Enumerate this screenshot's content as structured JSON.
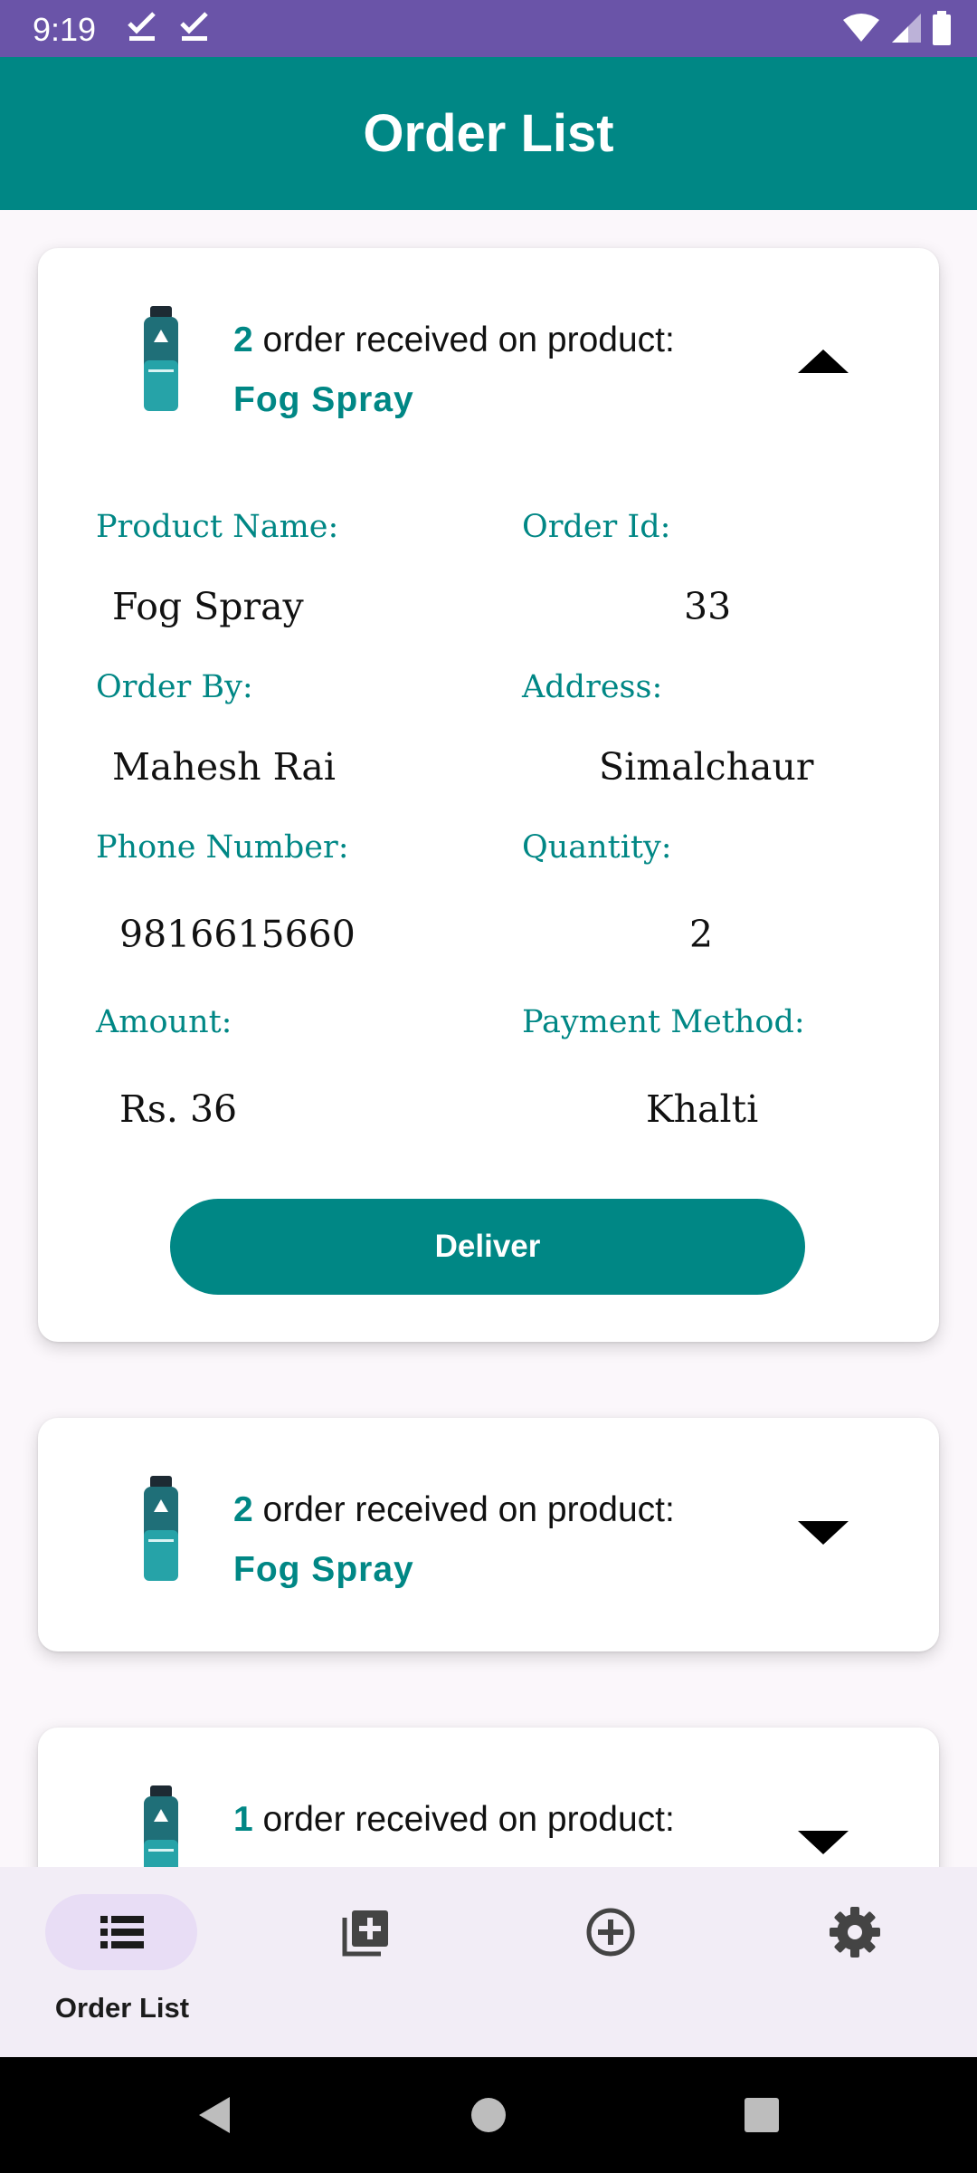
{
  "status_bar": {
    "time": "9:19",
    "icons": [
      "check-icon",
      "check-icon",
      "wifi-icon",
      "signal-icon",
      "battery-icon"
    ]
  },
  "app_bar": {
    "title": "Order List"
  },
  "colors": {
    "primary": "#008785",
    "status_bar": "#6a54a8",
    "nav_background": "#f2edf6",
    "nav_active_pill": "#e8ddf5"
  },
  "orders": [
    {
      "count": "2",
      "text": "order received on product:",
      "product": "Fog Spray",
      "expanded": true,
      "details": {
        "product_name_label": "Product Name:",
        "product_name": "Fog Spray",
        "order_id_label": "Order Id:",
        "order_id": "33",
        "order_by_label": "Order By:",
        "order_by": "Mahesh Rai",
        "address_label": "Address:",
        "address": "Simalchaur",
        "phone_label": "Phone Number:",
        "phone": "9816615660",
        "quantity_label": "Quantity:",
        "quantity": "2",
        "amount_label": "Amount:",
        "amount": "Rs. 36",
        "payment_label": "Payment Method:",
        "payment": "Khalti"
      },
      "deliver_label": "Deliver"
    },
    {
      "count": "2",
      "text": "order received on product:",
      "product": "Fog Spray",
      "expanded": false
    },
    {
      "count": "1",
      "text": "order received on product:",
      "product": "",
      "expanded": false
    }
  ],
  "bottom_nav": {
    "items": [
      {
        "icon": "list-icon",
        "label": "Order List",
        "active": true
      },
      {
        "icon": "add-library-icon",
        "label": "",
        "active": false
      },
      {
        "icon": "add-circle-icon",
        "label": "",
        "active": false
      },
      {
        "icon": "settings-icon",
        "label": "",
        "active": false
      }
    ]
  },
  "system_nav": {
    "icons": [
      "back-icon",
      "home-icon",
      "recents-icon"
    ]
  }
}
